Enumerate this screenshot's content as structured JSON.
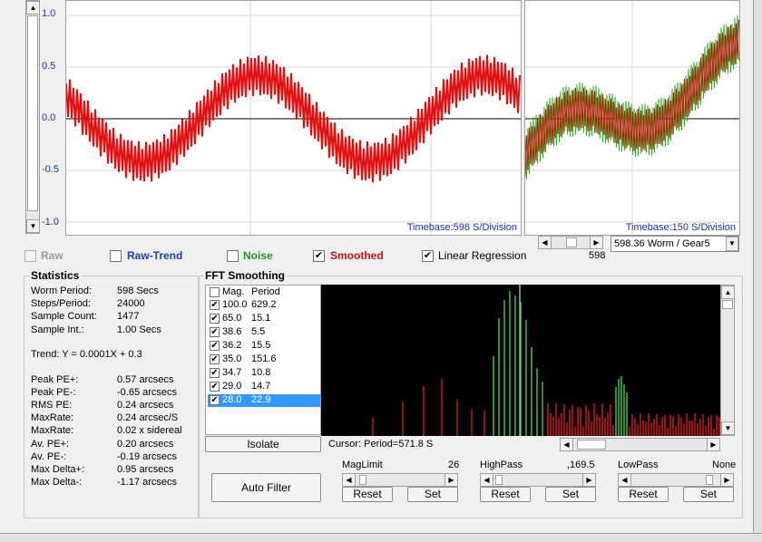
{
  "main_plot": {
    "y_ticks": [
      "1.0",
      "0.5",
      "0.0",
      "-0.5",
      "-1.0"
    ],
    "timebase": "Timebase:598 S/Division"
  },
  "right_plot": {
    "timebase": "Timebase:150 S/Division",
    "scroll_value": "598",
    "worm_select": "598.36 Worm / Gear5"
  },
  "options": {
    "raw": "Raw",
    "raw_trend": "Raw-Trend",
    "noise": "Noise",
    "smoothed": "Smoothed",
    "linear_regression": "Linear Regression",
    "colors": {
      "raw_trend": "#1a3fbf",
      "noise": "#1e9e1e",
      "smoothed": "#d0101a"
    }
  },
  "statistics": {
    "title": "Statistics",
    "rows": [
      {
        "label": "Worm Period:",
        "value": "598 Secs"
      },
      {
        "label": "Steps/Period:",
        "value": "24000"
      },
      {
        "label": "Sample Count:",
        "value": "1477"
      },
      {
        "label": "Sample Int.:",
        "value": "1.00 Secs"
      }
    ],
    "trend": "Trend: Y = 0.0001X + 0.3",
    "pe_rows": [
      {
        "label": "Peak PE+:",
        "value": "0.57 arcsecs"
      },
      {
        "label": "Peak PE-:",
        "value": "-0.65 arcsecs"
      },
      {
        "label": "RMS PE:",
        "value": "0.24 arcsecs"
      },
      {
        "label": "MaxRate:",
        "value": "0.24 arcsec/S"
      },
      {
        "label": "MaxRate:",
        "value": "0.02 x sidereal"
      },
      {
        "label": "Av. PE+:",
        "value": "0.20 arcsecs"
      },
      {
        "label": "Av. PE-:",
        "value": "-0.19 arcsecs"
      },
      {
        "label": "Max Delta+:",
        "value": "0.95 arcsecs"
      },
      {
        "label": "Max Delta-:",
        "value": "-1.17 arcsecs"
      }
    ],
    "auto_filter": "Auto Filter"
  },
  "fft": {
    "title": "FFT Smoothing",
    "col_mag": "Mag.",
    "col_period": "Period",
    "rows": [
      {
        "mag": "100.0",
        "period": "629.2"
      },
      {
        "mag": "65.0",
        "period": "15.1"
      },
      {
        "mag": "38.6",
        "period": "5.5"
      },
      {
        "mag": "36.2",
        "period": "15.5"
      },
      {
        "mag": "35.0",
        "period": "151.6"
      },
      {
        "mag": "34.7",
        "period": "10.8"
      },
      {
        "mag": "29.0",
        "period": "14.7"
      },
      {
        "mag": "28.0",
        "period": "22.9"
      }
    ],
    "isolate": "Isolate",
    "cursor": "Cursor: Period=571.8 S"
  },
  "filters": {
    "maglimit_label": "MagLimit",
    "maglimit_value": "26",
    "highpass_label": "HighPass",
    "highpass_value": ",169.5",
    "lowpass_label": "LowPass",
    "lowpass_value": "None",
    "reset": "Reset",
    "set": "Set"
  }
}
